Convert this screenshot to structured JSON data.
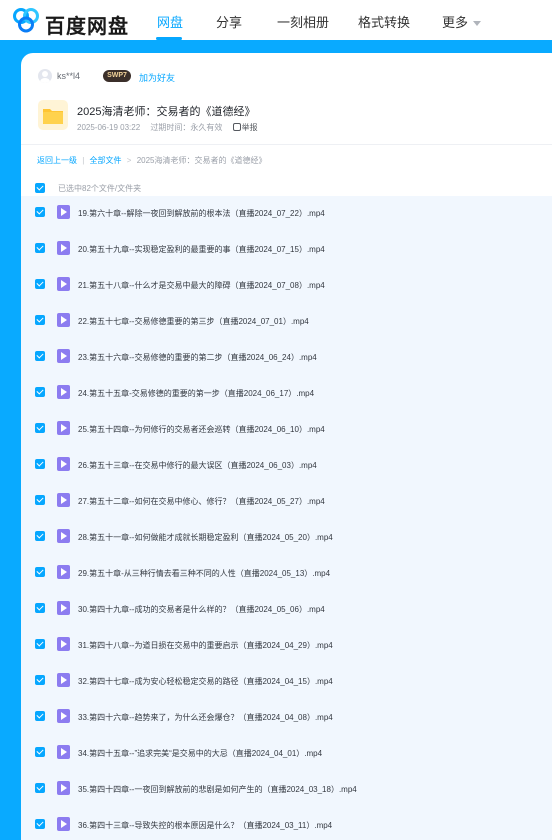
{
  "brand": {
    "name": "百度网盘"
  },
  "nav": {
    "items": [
      {
        "label": "网盘",
        "active": true
      },
      {
        "label": "分享",
        "active": false
      },
      {
        "label": "一刻相册",
        "active": false
      },
      {
        "label": "格式转换",
        "active": false
      },
      {
        "label": "更多",
        "active": false
      }
    ]
  },
  "share": {
    "username": "ks**l4",
    "badge": "SWP7",
    "add_friend": "加为好友",
    "title": "2025海清老师：交易者的《道德经》",
    "date": "2025-06-19 03:22",
    "expiry": "过期时间：永久有效",
    "report": "举报"
  },
  "breadcrumb": {
    "back": "返回上一级",
    "sep": "|",
    "all_files": "全部文件",
    "arrow": ">",
    "current": "2025海清老师：交易者的《道德经》"
  },
  "list": {
    "selected_text": "已选中82个文件/文件夹",
    "files": [
      "19.第六十章--解除一夜回到解放前的根本法（直播2024_07_22）.mp4",
      "20.第五十九章--实现稳定盈利的最重要的事（直播2024_07_15）.mp4",
      "21.第五十八章--什么才是交易中最大的障碍（直播2024_07_08）.mp4",
      "22.第五十七章--交易修德重要的第三步（直播2024_07_01）.mp4",
      "23.第五十六章--交易修德的重要的第二步（直播2024_06_24）.mp4",
      "24.第五十五章-交易修德的重要的第一步（直播2024_06_17）.mp4",
      "25.第五十四章--为何修行的交易者还会巡转（直播2024_06_10）.mp4",
      "26.第五十三章--在交易中修行的最大误区（直播2024_06_03）.mp4",
      "27.第五十二章--如何在交易中修心、修行？（直播2024_05_27）.mp4",
      "28.第五十一章--如何做能才成就长期稳定盈利（直播2024_05_20）.mp4",
      "29.第五十章-从三种行情去看三种不同的人性（直播2024_05_13）.mp4",
      "30.第四十九章--成功的交易者是什么样的？（直播2024_05_06）.mp4",
      "31.第四十八章--为道日损在交易中的重要启示（直播2024_04_29）.mp4",
      "32.第四十七章--成为安心轻松稳定交易的路径（直播2024_04_15）.mp4",
      "33.第四十六章--趋势来了，为什么还会爆仓？（直播2024_04_08）.mp4",
      "34.第四十五章--”追求完美“是交易中的大忌（直播2024_04_01）.mp4",
      "35.第四十四章--一夜回到解放前的悲剧是如何产生的（直播2024_03_18）.mp4",
      "36.第四十三章--导致失控的根本原因是什么？（直播2024_03_11）.mp4"
    ]
  },
  "colors": {
    "accent": "#06a7ff",
    "band": "#09aaff",
    "row_bg": "#f1f7fe",
    "video_icon": "#8c7cf0",
    "folder": "#ffc533"
  },
  "icons": {
    "logo": "baidu-netdisk-logo-icon",
    "folder": "folder-icon",
    "file": "video-file-icon",
    "avatar": "user-avatar-icon",
    "report": "report-icon",
    "check": "checkbox-checked-icon",
    "caret": "chevron-down-icon"
  }
}
